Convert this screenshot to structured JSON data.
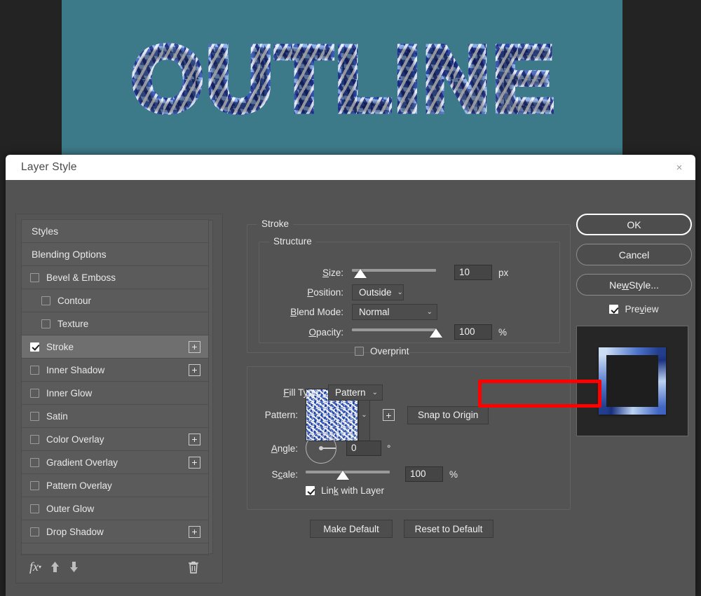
{
  "canvas": {
    "artboard_text": "OUTLINE",
    "background_color": "#3d7a89",
    "app_background_color": "#232323"
  },
  "dialog": {
    "title": "Layer Style",
    "close_icon": "×"
  },
  "styles_panel": {
    "rows": [
      {
        "label": "Styles",
        "type": "header",
        "checkbox": null,
        "plus": false,
        "indent": false,
        "selected": false
      },
      {
        "label": "Blending Options",
        "type": "header",
        "checkbox": null,
        "plus": false,
        "indent": false,
        "selected": false
      },
      {
        "label": "Bevel & Emboss",
        "type": "effect",
        "checkbox": false,
        "plus": false,
        "indent": false,
        "selected": false
      },
      {
        "label": "Contour",
        "type": "effect",
        "checkbox": false,
        "plus": false,
        "indent": true,
        "selected": false
      },
      {
        "label": "Texture",
        "type": "effect",
        "checkbox": false,
        "plus": false,
        "indent": true,
        "selected": false
      },
      {
        "label": "Stroke",
        "type": "effect",
        "checkbox": true,
        "plus": true,
        "indent": false,
        "selected": true
      },
      {
        "label": "Inner Shadow",
        "type": "effect",
        "checkbox": false,
        "plus": true,
        "indent": false,
        "selected": false
      },
      {
        "label": "Inner Glow",
        "type": "effect",
        "checkbox": false,
        "plus": false,
        "indent": false,
        "selected": false
      },
      {
        "label": "Satin",
        "type": "effect",
        "checkbox": false,
        "plus": false,
        "indent": false,
        "selected": false
      },
      {
        "label": "Color Overlay",
        "type": "effect",
        "checkbox": false,
        "plus": true,
        "indent": false,
        "selected": false
      },
      {
        "label": "Gradient Overlay",
        "type": "effect",
        "checkbox": false,
        "plus": true,
        "indent": false,
        "selected": false
      },
      {
        "label": "Pattern Overlay",
        "type": "effect",
        "checkbox": false,
        "plus": false,
        "indent": false,
        "selected": false
      },
      {
        "label": "Outer Glow",
        "type": "effect",
        "checkbox": false,
        "plus": false,
        "indent": false,
        "selected": false
      },
      {
        "label": "Drop Shadow",
        "type": "effect",
        "checkbox": false,
        "plus": true,
        "indent": false,
        "selected": false
      }
    ],
    "toolbar": {
      "fx_icon": "fx-icon",
      "move_up_icon": "arrow-up-icon",
      "move_down_icon": "arrow-down-icon",
      "delete_icon": "trash-icon"
    }
  },
  "stroke": {
    "legend": "Stroke",
    "structure": {
      "legend": "Structure",
      "size": {
        "label": "Size:",
        "value": "10",
        "unit": "px",
        "slider_percent": 8
      },
      "position": {
        "label": "Position:",
        "value": "Outside"
      },
      "blend_mode": {
        "label": "Blend Mode:",
        "value": "Normal"
      },
      "opacity": {
        "label": "Opacity:",
        "value": "100",
        "unit": "%",
        "slider_percent": 100
      },
      "overprint": {
        "label": "Overprint",
        "checked": false
      }
    },
    "fill_type": {
      "label": "Fill Type:",
      "value": "Pattern",
      "highlight_color": "#ff0000"
    },
    "pattern": {
      "label": "Pattern:",
      "swatch_name": "blue-ice-pattern-swatch",
      "new_preset_label": "+",
      "snap_to_origin_label": "Snap to Origin",
      "angle": {
        "label": "Angle:",
        "value": "0",
        "unit": "°"
      },
      "scale": {
        "label": "Scale:",
        "value": "100",
        "unit": "%",
        "slider_percent": 44
      },
      "link_with_layer": {
        "label": "Link with Layer",
        "checked": true
      }
    },
    "make_default_label": "Make Default",
    "reset_to_default_label": "Reset to Default"
  },
  "right_column": {
    "ok_label": "OK",
    "cancel_label": "Cancel",
    "new_style_label": "New Style...",
    "preview": {
      "label": "Preview",
      "checked": true
    },
    "preview_thumb_name": "stroke-preview-thumbnail"
  }
}
